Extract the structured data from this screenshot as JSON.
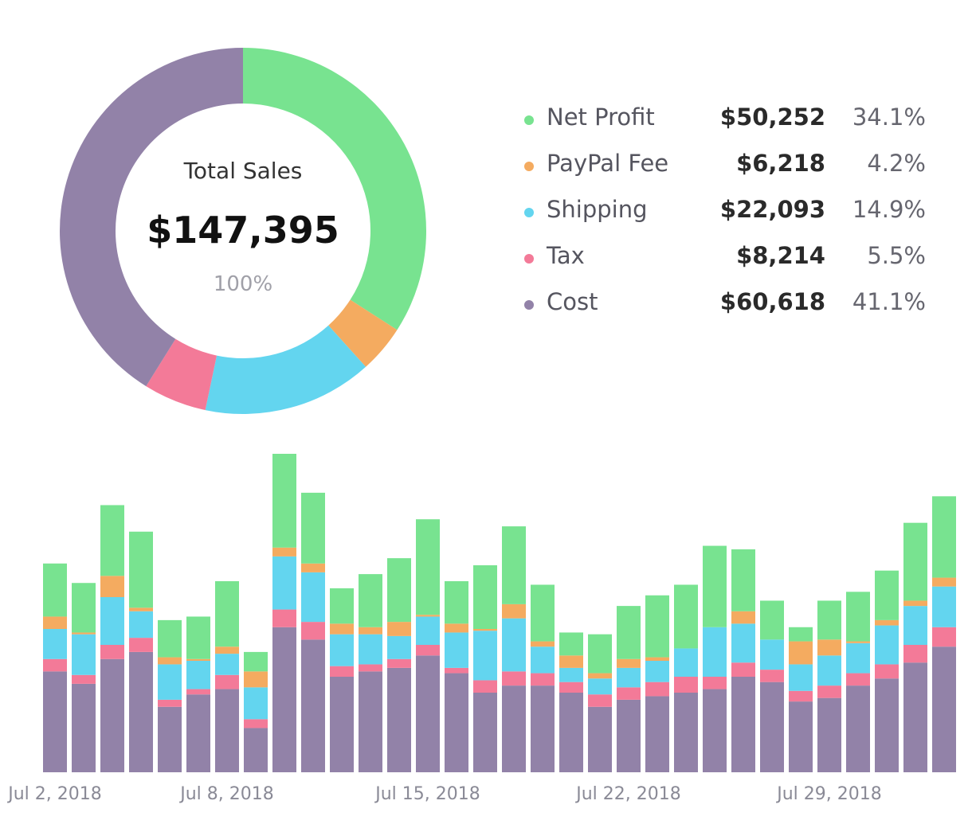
{
  "donut": {
    "title": "Total Sales",
    "total": "$147,395",
    "percent": "100%"
  },
  "legend": [
    {
      "label": "Net Profit",
      "amount": "$50,252",
      "percent": "34.1%",
      "color": "#78e390"
    },
    {
      "label": "PayPal Fee",
      "amount": "$6,218",
      "percent": "4.2%",
      "color": "#f4ab60"
    },
    {
      "label": "Shipping",
      "amount": "$22,093",
      "percent": "14.9%",
      "color": "#63d5ef"
    },
    {
      "label": "Tax",
      "amount": "$8,214",
      "percent": "5.5%",
      "color": "#f37a98"
    },
    {
      "label": "Cost",
      "amount": "$60,618",
      "percent": "41.1%",
      "color": "#9282a8"
    }
  ],
  "chart_data": [
    {
      "type": "pie",
      "categories": [
        "Net Profit",
        "PayPal Fee",
        "Shipping",
        "Tax",
        "Cost"
      ],
      "values": [
        50252,
        6218,
        22093,
        8214,
        60618
      ],
      "percentages": [
        34.1,
        4.2,
        14.9,
        5.5,
        41.1
      ],
      "colors": [
        "#78e390",
        "#f4ab60",
        "#63d5ef",
        "#f37a98",
        "#9282a8"
      ],
      "donut": true
    },
    {
      "type": "bar",
      "stacked": true,
      "x_tick_labels": [
        "Jul 2, 2018",
        "Jul 8, 2018",
        "Jul 15, 2018",
        "Jul 22, 2018",
        "Jul 29, 2018"
      ],
      "x_tick_index": [
        1,
        7,
        14,
        21,
        28
      ],
      "ylim": [
        0,
        90
      ],
      "grid": false,
      "series": [
        {
          "name": "Cost",
          "color": "#9282a8",
          "values": [
            28.5,
            25,
            32,
            34,
            18.5,
            22,
            23.5,
            12.5,
            41,
            37.5,
            27,
            28.5,
            29.5,
            33,
            28,
            22.5,
            24.5,
            24.5,
            22.5,
            18.5,
            20.5,
            21.5,
            22.5,
            23.5,
            27,
            25.5,
            20,
            21,
            24.5,
            26.5,
            31,
            35.5
          ]
        },
        {
          "name": "Tax",
          "color": "#f37a98",
          "values": [
            3.5,
            2.5,
            4,
            4,
            2,
            1.5,
            4,
            2.5,
            5,
            5,
            3,
            2,
            2.5,
            3,
            1.5,
            3.5,
            4,
            3.5,
            3,
            3.5,
            3.5,
            4,
            4.5,
            3.5,
            4,
            3.5,
            3,
            3.5,
            3.5,
            4,
            5,
            5.5
          ]
        },
        {
          "name": "Shipping",
          "color": "#63d5ef",
          "values": [
            8.5,
            11.5,
            13.5,
            7.5,
            10,
            8,
            6,
            9,
            15,
            14,
            9,
            8.5,
            6.5,
            8,
            10,
            14,
            15,
            7.5,
            4,
            4.5,
            5.5,
            6,
            8,
            14,
            11,
            8.5,
            7.5,
            8.5,
            8.5,
            11,
            11,
            11.5
          ]
        },
        {
          "name": "PayPal Fee",
          "color": "#f4ab60",
          "values": [
            3.5,
            0.5,
            6,
            1,
            2,
            0.5,
            2,
            4.5,
            2.5,
            2.5,
            3,
            2,
            4,
            0.5,
            2.5,
            0.5,
            4,
            1.5,
            3.5,
            1.5,
            2.5,
            1,
            0,
            0,
            3.5,
            0,
            6.5,
            4.5,
            0.5,
            1.5,
            1.5,
            2.5
          ]
        },
        {
          "name": "Net Profit",
          "color": "#78e390",
          "values": [
            15,
            14,
            20,
            21.5,
            10.5,
            12,
            18.5,
            5.5,
            26.5,
            20,
            10,
            15,
            18,
            27,
            12,
            18,
            22,
            16,
            6.5,
            11,
            15,
            17.5,
            18,
            23,
            17.5,
            11,
            4,
            11,
            14,
            14,
            22,
            23
          ]
        }
      ]
    }
  ]
}
